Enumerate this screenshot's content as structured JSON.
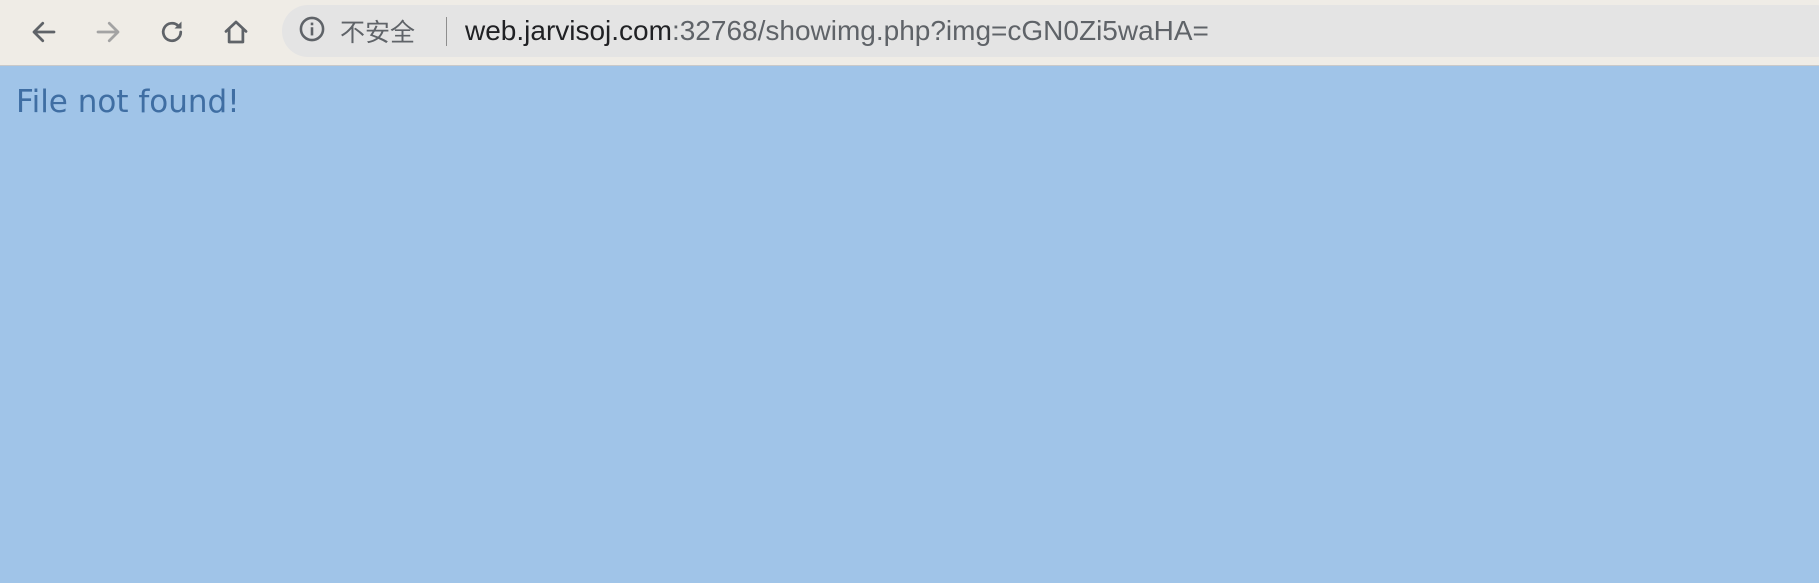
{
  "browser": {
    "nav": {
      "back_icon": "arrow-left-icon",
      "forward_icon": "arrow-right-icon",
      "reload_icon": "reload-icon",
      "home_icon": "home-icon"
    },
    "omnibox": {
      "security_icon": "info-circle-icon",
      "security_label": "不安全",
      "url_host": "web.jarvisoj.com",
      "url_rest": ":32768/showimg.php?img=cGN0Zi5waHA="
    }
  },
  "page": {
    "message": "File not found!"
  },
  "colors": {
    "toolbar_bg": "#efece6",
    "omnibox_bg": "#e4e4e4",
    "page_bg": "#a0c4e8",
    "message_text": "#3f6ea3",
    "icon": "#5f6368",
    "icon_disabled": "#a3a3a3"
  }
}
